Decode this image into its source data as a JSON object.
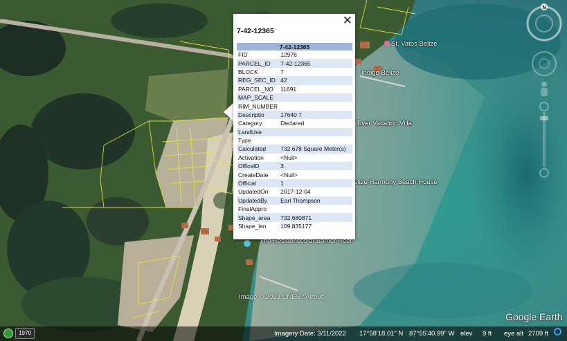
{
  "popup": {
    "title": "7-42-12365",
    "close_label": "✕",
    "table_header": "7-42-12365",
    "rows": [
      {
        "key": "FID",
        "value": "12976"
      },
      {
        "key": "PARCEL_ID",
        "value": "7-42-12365"
      },
      {
        "key": "BLOCK",
        "value": "7"
      },
      {
        "key": "REG_SEC_ID",
        "value": "42"
      },
      {
        "key": "PARCEL_NO",
        "value": "11691"
      },
      {
        "key": "MAP_SCALE",
        "value": ""
      },
      {
        "key": "RIM_NUMBER",
        "value": ""
      },
      {
        "key": "Descriptio",
        "value": "17640 7"
      },
      {
        "key": "Category",
        "value": "Declared"
      },
      {
        "key": "LandUse",
        "value": ""
      },
      {
        "key": "Type",
        "value": ""
      },
      {
        "key": "Calculated",
        "value": "732.678 Square Meter(s)"
      },
      {
        "key": "Activation",
        "value": "<Null>"
      },
      {
        "key": "OfficeID",
        "value": "3"
      },
      {
        "key": "CreateDate",
        "value": "<Null>"
      },
      {
        "key": "Official",
        "value": "1"
      },
      {
        "key": "UpdatedOn",
        "value": "2017-12-04"
      },
      {
        "key": "UpdatedBy",
        "value": "Earl Thompson"
      },
      {
        "key": "FinalAppro",
        "value": ""
      },
      {
        "key": "Shape_area",
        "value": "732.680871"
      },
      {
        "key": "Shape_len",
        "value": "109.835177"
      }
    ]
  },
  "places": {
    "p1": "St. Vatos Belize",
    "p2": "Indigo Belize",
    "p3": "Ever Vacation Villa",
    "p4": "Belize Harmony Beach House",
    "p5": "The Residences at Barrier Reef"
  },
  "map": {
    "copyright": "Image © 2023 CNES / Airbus",
    "logo": "Google Earth",
    "compass_letter": "N"
  },
  "statusbar": {
    "year": "1970",
    "imagery_date": "Imagery Date: 3/11/2022",
    "lat": "17°58'18.01\" N",
    "lon": "87°55'40.99\" W",
    "elev_label": "elev",
    "elev_value": "9 ft",
    "eye_alt_label": "eye alt",
    "eye_alt_value": "2709 ft"
  },
  "icons": {
    "clock": "historical-imagery-icon",
    "stream": "streaming-status-icon",
    "place_marker": "pink-place-marker-icon"
  },
  "colors": {
    "parcel_lines": "#e8e83a",
    "table_header": "#9db4d8",
    "row_alt": "#dde6f4"
  }
}
